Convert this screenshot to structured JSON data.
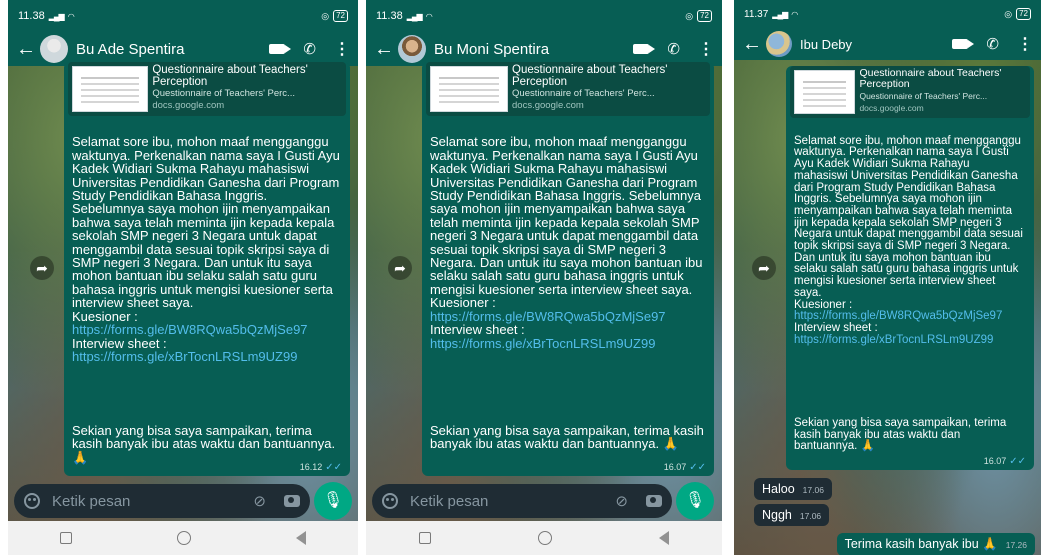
{
  "colors": {
    "header_bg": "#075e54",
    "bubble_out": "#075e54",
    "bubble_in": "#1f2c34",
    "link": "#53bdeb",
    "mic_button": "#00a884",
    "nav_bg": "#f1f1f1"
  },
  "common": {
    "link_preview": {
      "title": "Questionnaire about Teachers' Perception",
      "subtitle": "Questionnaire of Teachers' Perc...",
      "domain": "docs.google.com"
    },
    "message_body": "Selamat sore ibu, mohon maaf mengganggu waktunya. Perkenalkan nama saya I Gusti Ayu Kadek Widiari Sukma Rahayu mahasiswi Universitas Pendidikan Ganesha dari Program Study Pendidikan Bahasa Inggris. Sebelumnya saya mohon ijin menyampaikan bahwa saya telah meminta ijin kepada kepala sekolah SMP negeri 3 Negara untuk dapat menggambil data sesuai topik skripsi saya di SMP negeri 3 Negara. Dan untuk itu saya mohon bantuan ibu selaku salah satu guru bahasa inggris untuk mengisi kuesioner serta interview sheet saya.",
    "kuesioner_label": "Kuesioner :",
    "kuesioner_link": "https://forms.gle/BW8RQwa5bQzMjSe97",
    "interview_label": "Interview sheet :",
    "interview_link": "https://forms.gle/xBrTocnLRSLm9UZ99",
    "closing": "Sekian yang bisa saya sampaikan, terima kasih banyak ibu atas waktu dan bantuannya. 🙏",
    "input_placeholder": "Ketik pesan",
    "icons": {
      "back": "arrow-left",
      "video": "video-call",
      "call": "phone",
      "more": "more-vertical",
      "forward": "forward-arrow",
      "emoji": "emoji-smile",
      "attach": "paperclip",
      "camera": "camera",
      "mic": "microphone"
    }
  },
  "phones": [
    {
      "status_time": "11.38",
      "battery": "72",
      "contact_name": "Bu Ade Spentira",
      "message_time": "16.12",
      "read_ticks": "✓✓"
    },
    {
      "status_time": "11.38",
      "battery": "72",
      "contact_name": "Bu Moni Spentira",
      "message_time": "16.07",
      "read_ticks": "✓✓"
    },
    {
      "status_time": "11.37",
      "battery": "72",
      "contact_name": "Ibu Deby",
      "message_time": "16.07",
      "read_ticks": "✓✓",
      "replies": [
        {
          "text": "Haloo",
          "time": "17.06"
        },
        {
          "text": "Nggh",
          "time": "17.06"
        }
      ],
      "outgoing_reply": {
        "text": "Terima kasih banyak ibu 🙏",
        "time": "17.26"
      }
    }
  ]
}
